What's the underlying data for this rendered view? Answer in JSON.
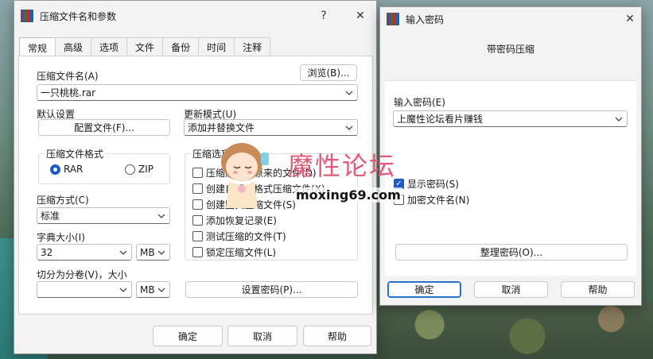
{
  "main_window": {
    "title": "压缩文件名和参数",
    "help_btn": "?",
    "close_btn": "✕",
    "tabs": [
      "常规",
      "高级",
      "选项",
      "文件",
      "备份",
      "时间",
      "注释"
    ],
    "archive_name_label": "压缩文件名(A)",
    "browse_button": "浏览(B)...",
    "archive_name_value": "一只桃桃.rar",
    "default_settings_label": "默认设置",
    "profiles_button": "配置文件(F)...",
    "update_mode_label": "更新模式(U)",
    "update_mode_value": "添加并替换文件",
    "archive_format_title": "压缩文件格式",
    "format_rar": "RAR",
    "format_zip": "ZIP",
    "compression_method_label": "压缩方式(C)",
    "compression_method_value": "标准",
    "dict_size_label": "字典大小(I)",
    "dict_size_value": "32",
    "dict_unit": "MB",
    "split_label": "切分为分卷(V)，大小",
    "split_value": "",
    "split_unit": "MB",
    "options_title": "压缩选项",
    "options": [
      {
        "label": "压缩后删除原来的文件(D)",
        "checked": false
      },
      {
        "label": "创建自解压格式压缩文件(X)",
        "checked": false
      },
      {
        "label": "创建固实压缩文件(S)",
        "checked": false
      },
      {
        "label": "添加恢复记录(E)",
        "checked": false
      },
      {
        "label": "测试压缩的文件(T)",
        "checked": false
      },
      {
        "label": "锁定压缩文件(L)",
        "checked": false
      }
    ],
    "set_password_button": "设置密码(P)...",
    "ok_button": "确定",
    "cancel_button": "取消",
    "help_button": "帮助"
  },
  "password_window": {
    "title": "输入密码",
    "close_btn": "✕",
    "subtitle": "带密码压缩",
    "password_label": "输入密码(E)",
    "password_value": "上魔性论坛看片赚钱",
    "show_password_label": "显示密码(S)",
    "show_password_checked": true,
    "encrypt_names_label": "加密文件名(N)",
    "encrypt_names_checked": false,
    "organize_button": "整理密码(O)...",
    "ok_button": "确定",
    "cancel_button": "取消",
    "help_button": "帮助"
  },
  "watermark": {
    "brand": "魔性论坛",
    "url": "moxing69.com"
  },
  "colors": {
    "accent": "#1e5bc6",
    "watermark_pink": "#e15a78"
  }
}
